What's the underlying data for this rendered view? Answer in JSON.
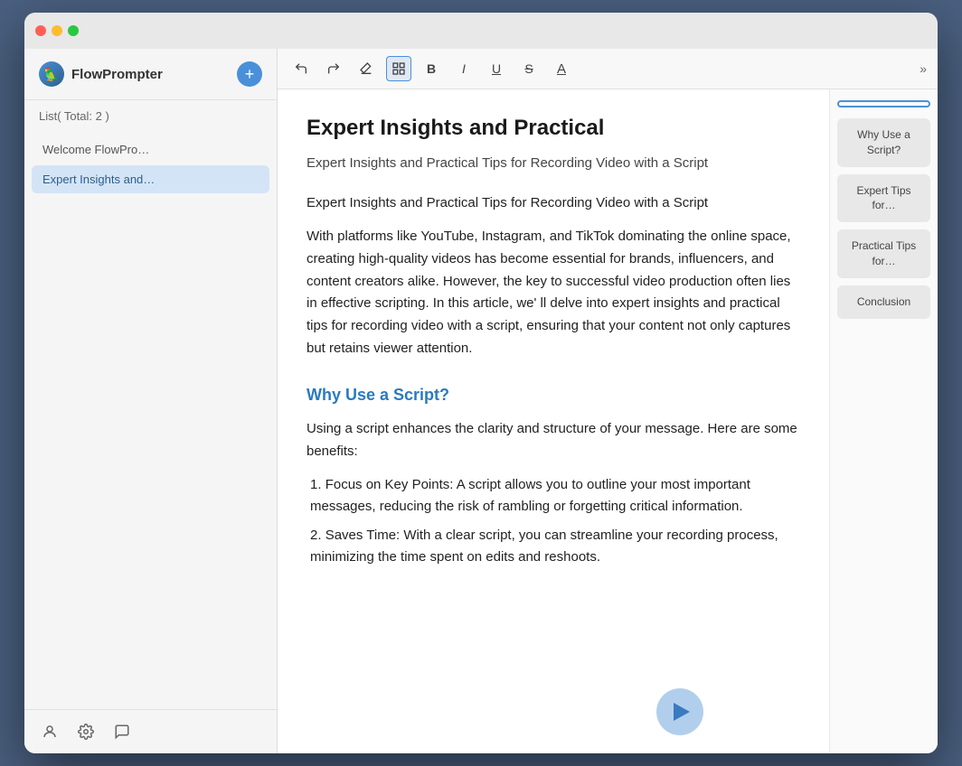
{
  "window": {
    "title": "FlowPrompter"
  },
  "sidebar": {
    "header": {
      "list_label": "List( Total: 2 )",
      "add_button_label": "+"
    },
    "items": [
      {
        "id": "welcome",
        "label": "Welcome FlowPro…",
        "active": false
      },
      {
        "id": "expert",
        "label": "Expert Insights and…",
        "active": true
      }
    ],
    "footer_icons": [
      {
        "name": "user-icon",
        "symbol": "👤"
      },
      {
        "name": "settings-icon",
        "symbol": "⚙"
      },
      {
        "name": "chat-icon",
        "symbol": "💬"
      }
    ]
  },
  "toolbar": {
    "buttons": [
      {
        "name": "undo-button",
        "label": "↩",
        "active": false
      },
      {
        "name": "redo-button",
        "label": "↪",
        "active": false
      },
      {
        "name": "erase-button",
        "label": "◻",
        "active": false
      },
      {
        "name": "block-button",
        "label": "⊞",
        "active": true
      },
      {
        "name": "bold-button",
        "label": "B",
        "active": false
      },
      {
        "name": "italic-button",
        "label": "I",
        "active": false
      },
      {
        "name": "underline-button",
        "label": "U",
        "active": false
      },
      {
        "name": "strikethrough-button",
        "label": "S",
        "active": false
      },
      {
        "name": "font-button",
        "label": "A",
        "active": false
      }
    ],
    "more_label": "»"
  },
  "document": {
    "title": "Expert Insights and Practical",
    "subtitle": "Expert Insights and Practical Tips for Recording Video with a Script",
    "body_intro": " Expert Insights and Practical Tips for Recording Video with a Script",
    "paragraph1": "With platforms like YouTube, Instagram, and TikTok dominating the online space, creating high-quality videos has become essential for brands, influencers, and content creators alike. However, the key to successful video production often lies in effective scripting. In this article, we' ll delve into expert insights and practical tips for recording video with a script, ensuring that your content not only captures but retains viewer attention.",
    "section1_heading": "Why Use a Script?",
    "section1_intro": " Using a script enhances the clarity and structure of your message. Here are some benefits:",
    "section1_items": [
      {
        "num": "1.",
        "text": "Focus on Key Points: A script allows you to outline your most important messages, reducing the risk of rambling or forgetting critical information."
      },
      {
        "num": "2.",
        "text": "Saves Time: With a clear script, you can streamline your recording process, minimizing the time spent on edits and reshoots."
      }
    ]
  },
  "toc": {
    "items": [
      {
        "id": "why-use-script",
        "label": "Why Use a Script?",
        "active": false
      },
      {
        "id": "expert-tips",
        "label": "Expert Tips for…",
        "active": false
      },
      {
        "id": "practical-tips",
        "label": "Practical Tips for…",
        "active": false
      },
      {
        "id": "conclusion",
        "label": "Conclusion",
        "active": false
      }
    ],
    "selected_indicator": "active-top"
  },
  "play_button": {
    "label": "▶"
  }
}
